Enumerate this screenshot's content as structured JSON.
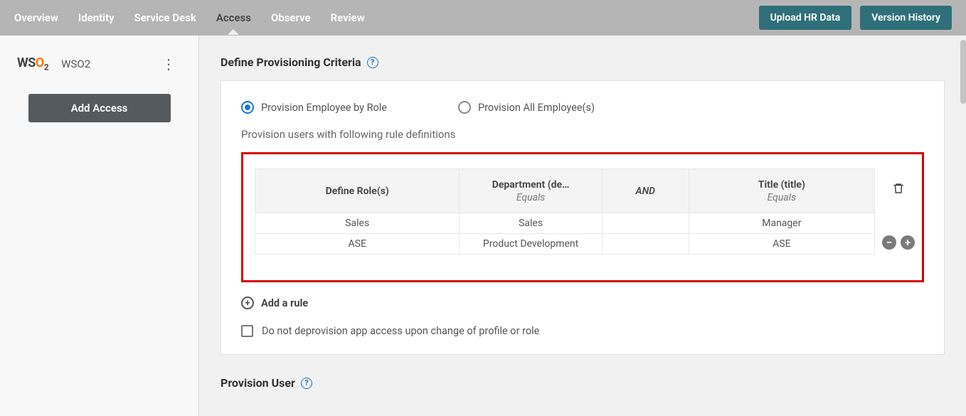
{
  "nav": {
    "items": [
      "Overview",
      "Identity",
      "Service Desk",
      "Access",
      "Observe",
      "Review"
    ],
    "active_index": 3,
    "upload_btn": "Upload HR Data",
    "version_btn": "Version History"
  },
  "sidebar": {
    "app_name": "WSO2",
    "add_access": "Add Access"
  },
  "section": {
    "title": "Define Provisioning Criteria",
    "radio_by_role": "Provision Employee by Role",
    "radio_all": "Provision All Employee(s)",
    "subtext": "Provision users with following rule definitions",
    "columns": {
      "role": "Define Role(s)",
      "dept": "Department (de…",
      "dept_op": "Equals",
      "and": "AND",
      "title": "Title (title)",
      "title_op": "Equals"
    },
    "rows": [
      {
        "role": "Sales",
        "dept": "Sales",
        "title": "Manager"
      },
      {
        "role": "ASE",
        "dept": "Product Development",
        "title": "ASE"
      }
    ],
    "add_rule": "Add a rule",
    "checkbox_label": "Do not deprovision app access upon change of profile or role"
  },
  "section2": {
    "title": "Provision User"
  }
}
